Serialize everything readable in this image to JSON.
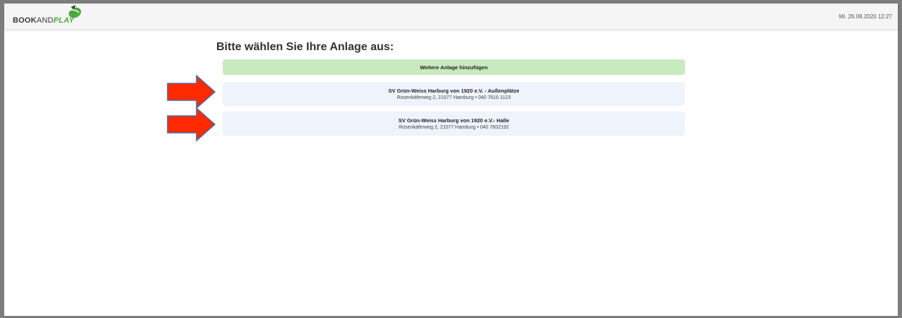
{
  "header": {
    "logo": {
      "part1": "BOOK",
      "part2": "AND",
      "part3": "PLAY",
      "icon": "tennis-ball-icon"
    },
    "datetime": "Mi. 26.08.2020 12:27"
  },
  "main": {
    "heading": "Bitte wählen Sie Ihre Anlage aus:",
    "add_button_label": "Weitere Anlage hinzufügen",
    "venues": [
      {
        "name": "SV Grün-Weiss Harburg von 1920 e.V. - Außenplätze",
        "address": "Rosenkäferweg 2, 21077 Hamburg • 040 7610 1123"
      },
      {
        "name": "SV Grün-Weiss Harburg von 1920 e.V.- Halle",
        "address": "Rosenkäferweg 2, 21077 Hamburg • 040 7602192"
      }
    ]
  },
  "colors": {
    "add_button_bg": "#c8eabf",
    "venue_bg": "#eef3fc",
    "arrow_fill": "#ff2a00",
    "arrow_stroke": "#4a6fa5",
    "brand_green": "#4caa3c"
  }
}
